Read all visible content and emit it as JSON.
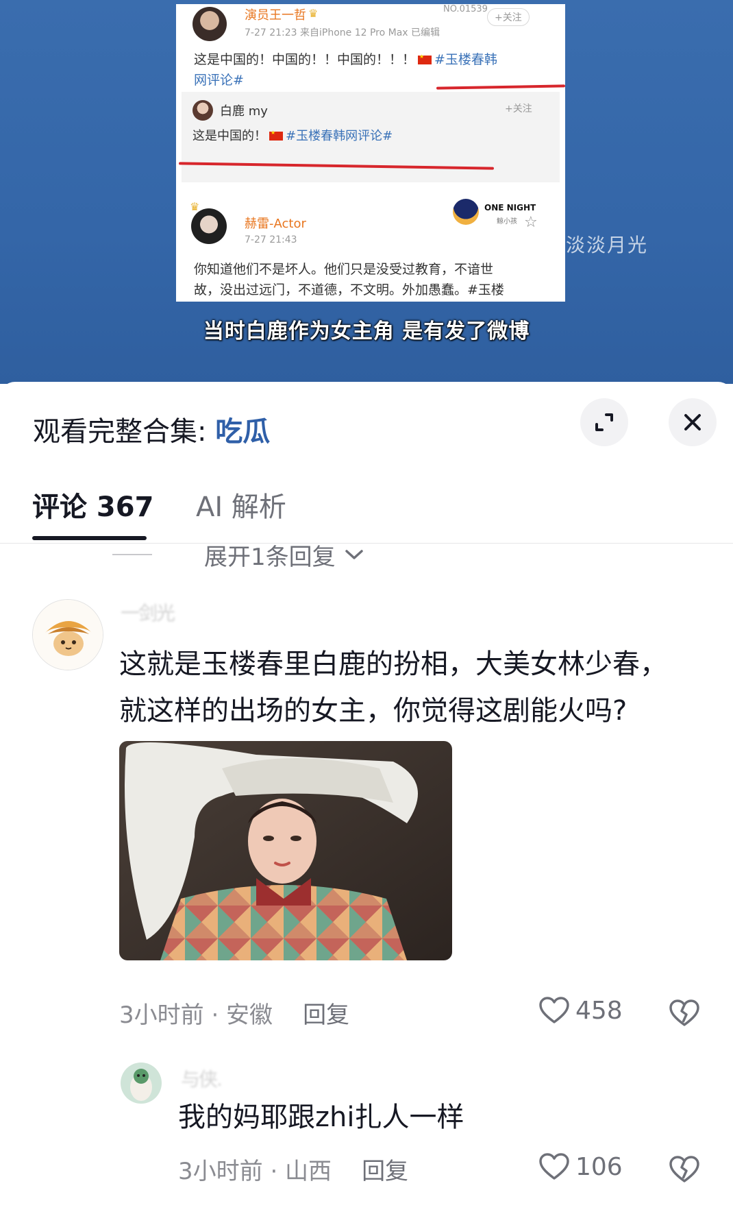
{
  "video": {
    "screenshot": {
      "post1": {
        "user": "演员王一哲",
        "meta": "7-27 21:23  来自iPhone 12 Pro Max  已编辑",
        "no": "NO.01539",
        "follow": "+关注",
        "text": "这是中国的！中国的！！中国的！！！",
        "tag_line1": "#玉楼春韩",
        "tag_line2": "网评论#"
      },
      "post2": {
        "user": "白鹿 my",
        "follow": "+关注",
        "text": "这是中国的！",
        "tag": "#玉楼春韩网评论#"
      },
      "post3": {
        "user": "赫雷-Actor",
        "meta": "7-27 21:43",
        "badge_title": "ONE NIGHT",
        "badge_sub": "鲸小孩",
        "text_line1": "你知道他们不是坏人。他们只是没受过教育，不谙世",
        "text_line2": "故，没出过远门，不道德，不文明。外加愚蠢。#玉楼"
      }
    },
    "watermark": "淡淡月光",
    "subtitle": "当时白鹿作为女主角 是有发了微博"
  },
  "sheet": {
    "header_prefix": "观看完整合集: ",
    "header_link": "吃瓜",
    "expand_icon": "expand-icon",
    "close_icon": "close-icon"
  },
  "tabs": [
    {
      "label": "评论 367",
      "active": true
    },
    {
      "label": "AI 解析",
      "active": false
    }
  ],
  "expand_replies": "展开1条回复",
  "comments": [
    {
      "user": "一剑光",
      "text_line1": "这就是玉楼春里白鹿的扮相，大美女林少春，",
      "text_line2": "就这样的出场的女主，你觉得这剧能火吗?",
      "time_loc": "3小时前 · 安徽",
      "reply": "回复",
      "likes": "458"
    },
    {
      "user": "与侠.",
      "text": "我的妈耶跟zhi扎人一样",
      "time_loc": "3小时前 · 山西",
      "reply": "回复",
      "likes": "106"
    }
  ],
  "colors": {
    "video_bg": "#3466a8",
    "link": "#2f5fa8",
    "weibo_tag": "#3a72b8",
    "weibo_name": "#e8761f",
    "red_underline": "#d7262c"
  }
}
